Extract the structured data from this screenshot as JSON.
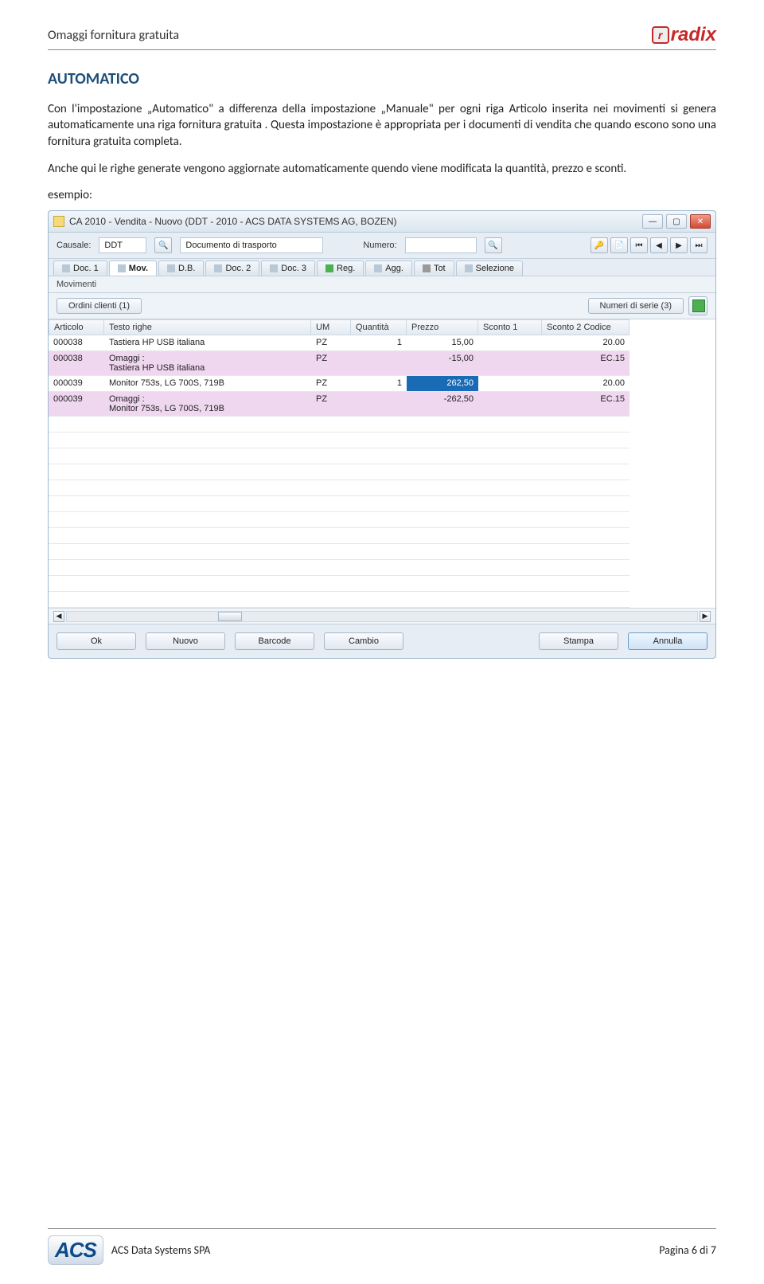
{
  "header": {
    "title": "Omaggi fornitura gratuita",
    "brand": "radix"
  },
  "section_heading": "AUTOMATICO",
  "para1": "Con l'impostazione „Automatico\" a differenza della impostazione „Manuale\" per ogni riga Articolo inserita nei movimenti si genera automaticamente una riga fornitura gratuita . Questa impostazione è appropriata per i documenti di vendita che quando escono sono una fornitura gratuita completa.",
  "para2": "Anche qui le righe generate vengono aggiornate automaticamente quendo viene modificata la quantità, prezzo e sconti.",
  "esempio_label": "esempio:",
  "app": {
    "title": "CA 2010 - Vendita - Nuovo (DDT - 2010 - ACS DATA SYSTEMS AG, BOZEN)",
    "causale_label": "Causale:",
    "causale_value": "DDT",
    "causale_desc": "Documento di trasporto",
    "numero_label": "Numero:",
    "tabs": [
      "Doc. 1",
      "Mov.",
      "D.B.",
      "Doc. 2",
      "Doc. 3",
      "Reg.",
      "Agg.",
      "Tot",
      "Selezione"
    ],
    "active_tab_index": 1,
    "movimenti_label": "Movimenti",
    "ordini_btn": "Ordini clienti (1)",
    "serie_btn": "Numeri di serie (3)",
    "grid_headers": [
      "Articolo",
      "Testo righe",
      "UM",
      "Quantità",
      "Prezzo",
      "Sconto 1",
      "Sconto 2 Codice"
    ],
    "rows": [
      {
        "art": "000038",
        "testo": "Tastiera HP USB italiana",
        "um": "PZ",
        "q": "1",
        "prezzo": "15,00",
        "s1": "",
        "s2": "20.00",
        "hl": false
      },
      {
        "art": "000038",
        "testo": "Omaggi :\nTastiera HP USB italiana",
        "um": "PZ",
        "q": "",
        "prezzo": "-15,00",
        "s1": "",
        "s2": "EC.15",
        "hl": true
      },
      {
        "art": "000039",
        "testo": "Monitor 753s, LG 700S, 719B",
        "um": "PZ",
        "q": "1",
        "prezzo": "262,50",
        "s1": "",
        "s2": "20.00",
        "hl": false,
        "sel": true
      },
      {
        "art": "000039",
        "testo": "Omaggi :\nMonitor 753s, LG 700S, 719B",
        "um": "PZ",
        "q": "",
        "prezzo": "-262,50",
        "s1": "",
        "s2": "EC.15",
        "hl": true
      }
    ],
    "buttons": {
      "ok": "Ok",
      "nuovo": "Nuovo",
      "barcode": "Barcode",
      "cambio": "Cambio",
      "stampa": "Stampa",
      "annulla": "Annulla"
    }
  },
  "footer": {
    "company": "ACS Data Systems SPA",
    "page": "Pagina 6 di  7",
    "mark": "ACS"
  }
}
